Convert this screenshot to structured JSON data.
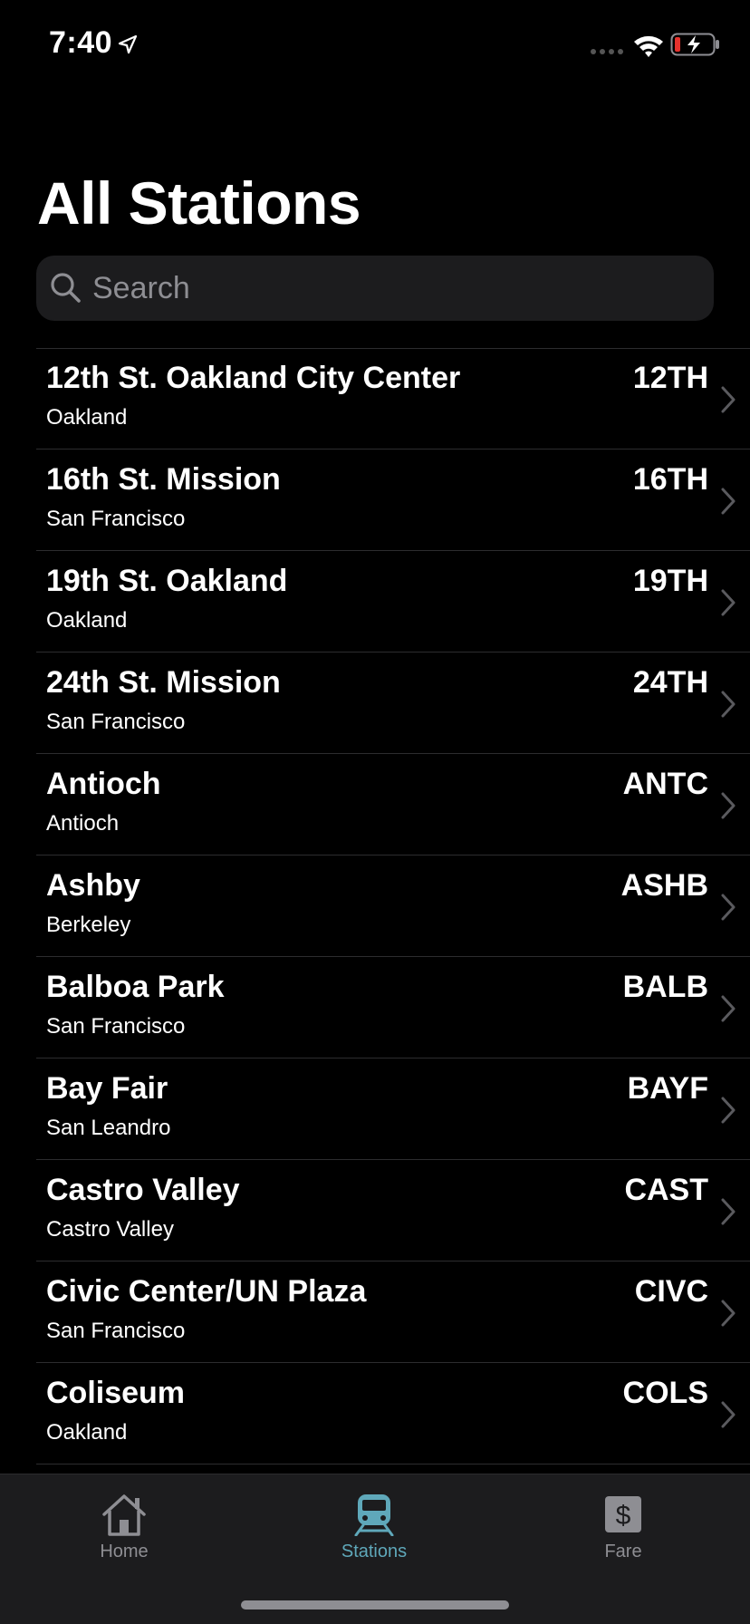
{
  "status_bar": {
    "time": "7:40"
  },
  "page": {
    "title": "All Stations"
  },
  "search": {
    "placeholder": "Search"
  },
  "stations": [
    {
      "name": "12th St. Oakland City Center",
      "city": "Oakland",
      "code": "12TH"
    },
    {
      "name": "16th St. Mission",
      "city": "San Francisco",
      "code": "16TH"
    },
    {
      "name": "19th St. Oakland",
      "city": "Oakland",
      "code": "19TH"
    },
    {
      "name": "24th St. Mission",
      "city": "San Francisco",
      "code": "24TH"
    },
    {
      "name": "Antioch",
      "city": "Antioch",
      "code": "ANTC"
    },
    {
      "name": "Ashby",
      "city": "Berkeley",
      "code": "ASHB"
    },
    {
      "name": "Balboa Park",
      "city": "San Francisco",
      "code": "BALB"
    },
    {
      "name": "Bay Fair",
      "city": "San Leandro",
      "code": "BAYF"
    },
    {
      "name": "Castro Valley",
      "city": "Castro Valley",
      "code": "CAST"
    },
    {
      "name": "Civic Center/UN Plaza",
      "city": "San Francisco",
      "code": "CIVC"
    },
    {
      "name": "Coliseum",
      "city": "Oakland",
      "code": "COLS"
    }
  ],
  "tab_bar": {
    "tabs": [
      {
        "label": "Home",
        "icon": "house-icon",
        "active": false
      },
      {
        "label": "Stations",
        "icon": "train-icon",
        "active": true
      },
      {
        "label": "Fare",
        "icon": "dollar-icon",
        "active": false
      }
    ]
  },
  "colors": {
    "background": "#000000",
    "accent": "#5fa8ba",
    "inactive_tab": "#8e8e93",
    "battery_low": "#e5322d"
  }
}
